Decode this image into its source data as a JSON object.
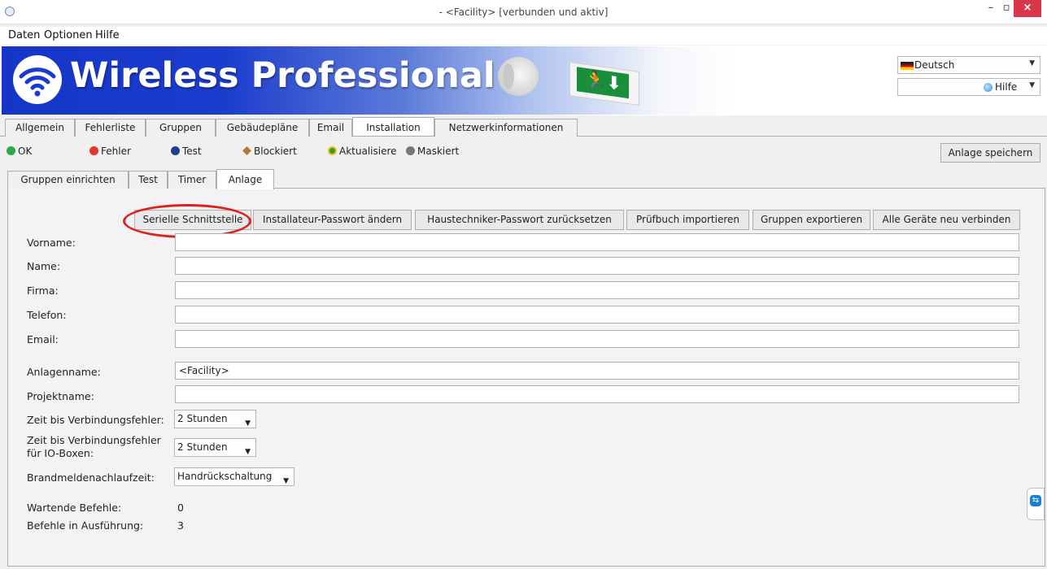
{
  "window": {
    "title": "- <Facility> [verbunden und aktiv]",
    "min": "–",
    "max": "▫",
    "close": "×"
  },
  "menu": {
    "items": [
      "Daten",
      "Optionen",
      "Hilfe"
    ]
  },
  "banner": {
    "brand": "Wireless Professional",
    "brand_color": "#1535c8",
    "exit_sign_glyphs": "🏃⬇"
  },
  "language": {
    "selected": "Deutsch"
  },
  "help": {
    "label": "Hilfe"
  },
  "main_tabs": [
    "Allgemein",
    "Fehlerliste",
    "Gruppen",
    "Gebäudepläne",
    "Email",
    "Installation",
    "Netzwerkinformationen"
  ],
  "main_tabs_active": "Installation",
  "legend": {
    "ok": "OK",
    "fehler": "Fehler",
    "test": "Test",
    "blockiert": "Blockiert",
    "aktualisiere": "Aktualisiere",
    "maskiert": "Maskiert",
    "colors": {
      "ok": "#2ea84a",
      "fehler": "#e0362b",
      "test": "#1f3f8a",
      "blockiert": "#b07830",
      "aktualisiere": "#3a9a2a",
      "maskiert": "#777777"
    }
  },
  "save_button": "Anlage speichern",
  "sub_tabs": [
    "Gruppen einrichten",
    "Test",
    "Timer",
    "Anlage"
  ],
  "sub_tabs_active": "Anlage",
  "actions": [
    "Serielle Schnittstelle",
    "Installateur-Passwort ändern",
    "Haustechniker-Passwort zurücksetzen",
    "Prüfbuch importieren",
    "Gruppen exportieren",
    "Alle Geräte neu verbinden"
  ],
  "form": {
    "vorname": {
      "label": "Vorname:",
      "value": ""
    },
    "name": {
      "label": "Name:",
      "value": ""
    },
    "firma": {
      "label": "Firma:",
      "value": ""
    },
    "telefon": {
      "label": "Telefon:",
      "value": ""
    },
    "email": {
      "label": "Email:",
      "value": ""
    },
    "anlagenname": {
      "label": "Anlagenname:",
      "value": "<Facility>"
    },
    "projektname": {
      "label": "Projektname:",
      "value": ""
    },
    "zeit_verbindung": {
      "label": "Zeit bis Verbindungsfehler:",
      "value": "2 Stunden"
    },
    "zeit_io_line1": "Zeit bis Verbindungsfehler",
    "zeit_io_line2": "für IO-Boxen:",
    "zeit_io_value": "2 Stunden",
    "brand": {
      "label": "Brandmeldenachlaufzeit:",
      "value": "Handrückschaltung"
    },
    "wartende": {
      "label": "Wartende Befehle:",
      "value": "0"
    },
    "ausfuehrung": {
      "label": "Befehle in Ausführung:",
      "value": "3"
    }
  },
  "highlight_color": "#e01e1e"
}
